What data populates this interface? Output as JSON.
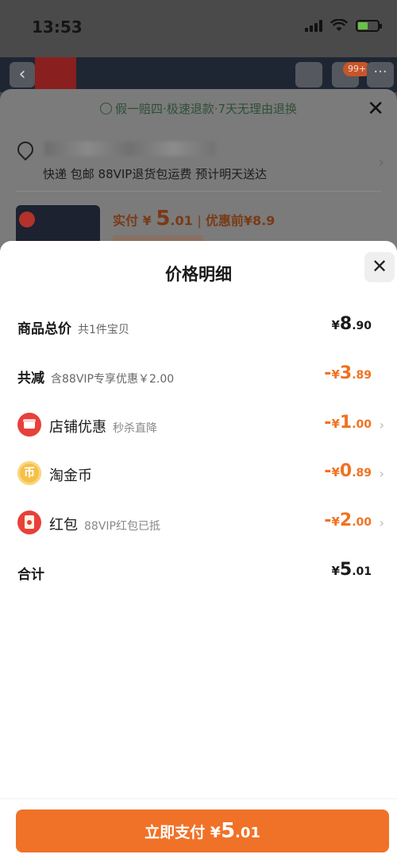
{
  "status": {
    "time": "13:53"
  },
  "background": {
    "cart_badge": "99+",
    "guarantee": "假一赔四·极速退款·7天无理由退换",
    "delivery": "快递 包邮 88VIP退货包运费 预计明天送达",
    "actual_pay_label": "实付",
    "actual_pay_int": "5",
    "actual_pay_dec": ".01",
    "before_discount": "优惠前",
    "before_discount_amount": "¥8.9",
    "yen": "¥"
  },
  "detail": {
    "title": "价格明细",
    "total": {
      "label": "商品总价",
      "sub": "共1件宝贝",
      "int": "8",
      "dec": ".90"
    },
    "reduce": {
      "label": "共减",
      "sub": "含88VIP专享优惠￥2.00",
      "int": "3",
      "dec": ".89"
    },
    "items": [
      {
        "icon": "shop-icon",
        "label": "店铺优惠",
        "sub": "秒杀直降",
        "int": "1",
        "dec": ".00"
      },
      {
        "icon": "coin-icon",
        "label": "淘金币",
        "sub": "",
        "int": "0",
        "dec": ".89"
      },
      {
        "icon": "red-packet-icon",
        "label": "红包",
        "sub": "88VIP红包已抵",
        "int": "2",
        "dec": ".00"
      }
    ],
    "sum": {
      "label": "合计",
      "int": "5",
      "dec": ".01"
    }
  },
  "pay_button": {
    "label": "立即支付",
    "yen": "¥",
    "int": "5",
    "dec": ".01"
  },
  "colors": {
    "accent": "#f07228",
    "discount": "#f07220",
    "shop_icon": "#e8403a",
    "coin_icon": "#f5c04a"
  }
}
